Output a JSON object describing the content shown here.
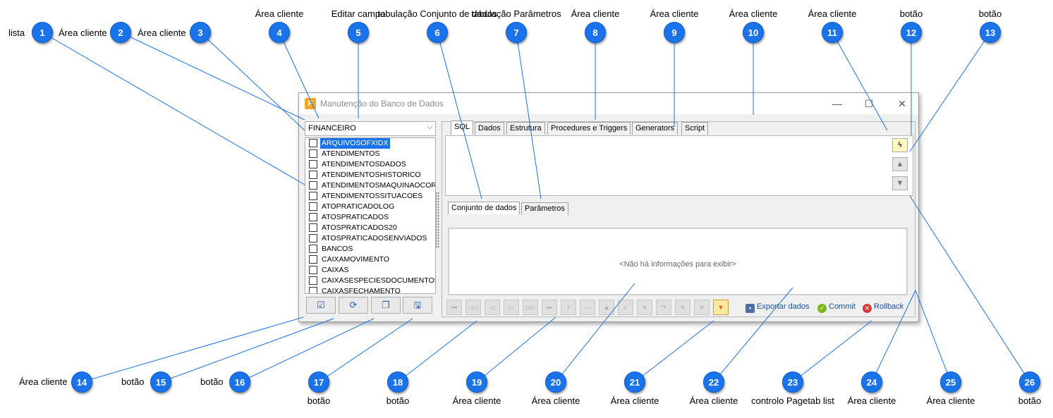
{
  "window": {
    "title": "Manutenção do Banco de Dados",
    "minimize": "—",
    "maximize": "☐",
    "close": "✕",
    "app_icon_letter": "F"
  },
  "database_combo": {
    "value": "FINANCEIRO"
  },
  "tables": [
    "ARQUIVOSOFXIDX",
    "ATENDIMENTOS",
    "ATENDIMENTOSDADOS",
    "ATENDIMENTOSHISTORICO",
    "ATENDIMENTOSMAQUINAOCORR",
    "ATENDIMENTOSSITUACOES",
    "ATOPRATICADOLOG",
    "ATOSPRATICADOS",
    "ATOSPRATICADOS20",
    "ATOSPRATICADOSENVIADOS",
    "BANCOS",
    "CAIXAMOVIMENTO",
    "CAIXAS",
    "CAIXASESPECIESDOCUMENTOS",
    "CAIXASFECHAMENTO"
  ],
  "left_buttons": [
    {
      "name": "check-all",
      "glyph": "☑"
    },
    {
      "name": "refresh",
      "glyph": "⟳"
    },
    {
      "name": "copy",
      "glyph": "❐"
    },
    {
      "name": "save",
      "glyph": "🖫"
    }
  ],
  "main_tabs": [
    "SQL",
    "Dados",
    "Estrutura",
    "Procedures e Triggers",
    "Generators",
    "Script"
  ],
  "side_buttons": [
    {
      "name": "execute",
      "glyph": "ϟ"
    },
    {
      "name": "up",
      "glyph": "▲"
    },
    {
      "name": "down",
      "glyph": "▼"
    }
  ],
  "content_tabs": [
    "Conjunto de dados",
    "Parâmetros"
  ],
  "grid": {
    "empty_text": "<Não há informações para exibir>"
  },
  "nav_buttons": [
    "⏮",
    "◁◁",
    "◁",
    "▷",
    "▷▷",
    "⏭",
    "+",
    "—",
    "▲",
    "✓",
    "✕",
    "↷",
    "✳",
    "✳",
    "▼"
  ],
  "actions": {
    "export": "Exportar dados",
    "commit": "Commit",
    "rollback": "Rollback"
  },
  "callouts": [
    {
      "n": "1",
      "label": "lista"
    },
    {
      "n": "2",
      "label": "Área cliente"
    },
    {
      "n": "3",
      "label": "Área cliente"
    },
    {
      "n": "4",
      "label": "Área cliente"
    },
    {
      "n": "5",
      "label": "Editar campo"
    },
    {
      "n": "6",
      "label": "tabulação Conjunto de dados"
    },
    {
      "n": "7",
      "label": "tabulação Parâmetros"
    },
    {
      "n": "8",
      "label": "Área cliente"
    },
    {
      "n": "9",
      "label": "Área cliente"
    },
    {
      "n": "10",
      "label": "Área cliente"
    },
    {
      "n": "11",
      "label": "Área cliente"
    },
    {
      "n": "12",
      "label": "botão"
    },
    {
      "n": "13",
      "label": "botão"
    },
    {
      "n": "14",
      "label": "Área cliente"
    },
    {
      "n": "15",
      "label": "botão"
    },
    {
      "n": "16",
      "label": "botão"
    },
    {
      "n": "17",
      "label": "botão"
    },
    {
      "n": "18",
      "label": "botão"
    },
    {
      "n": "19",
      "label": "Área cliente"
    },
    {
      "n": "20",
      "label": "Área cliente"
    },
    {
      "n": "21",
      "label": "Área cliente"
    },
    {
      "n": "22",
      "label": "Área cliente"
    },
    {
      "n": "23",
      "label": "controlo Pagetab list"
    },
    {
      "n": "24",
      "label": "Área cliente"
    },
    {
      "n": "25",
      "label": "Área cliente"
    },
    {
      "n": "26",
      "label": "botão"
    }
  ]
}
